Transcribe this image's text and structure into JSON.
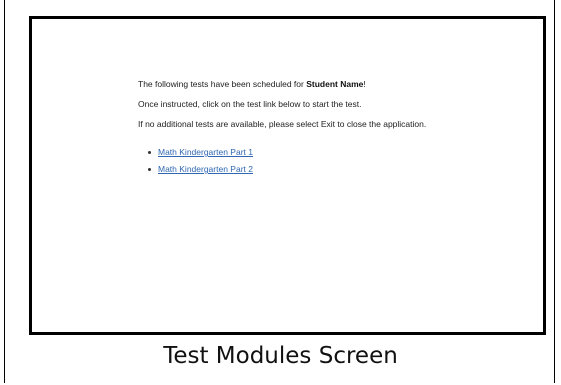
{
  "message": {
    "scheduled_prefix": "The following tests have been scheduled for ",
    "student_name": "Student Name",
    "scheduled_suffix": "!",
    "instruction": "Once instructed, click on the test link below to start the test.",
    "exit_note": "If no additional tests are available, please select Exit to close the application."
  },
  "tests": [
    {
      "label": "Math Kindergarten Part 1"
    },
    {
      "label": "Math Kindergarten Part 2"
    }
  ],
  "caption": "Test Modules Screen",
  "colors": {
    "link": "#2f67b2",
    "border": "#000000"
  }
}
